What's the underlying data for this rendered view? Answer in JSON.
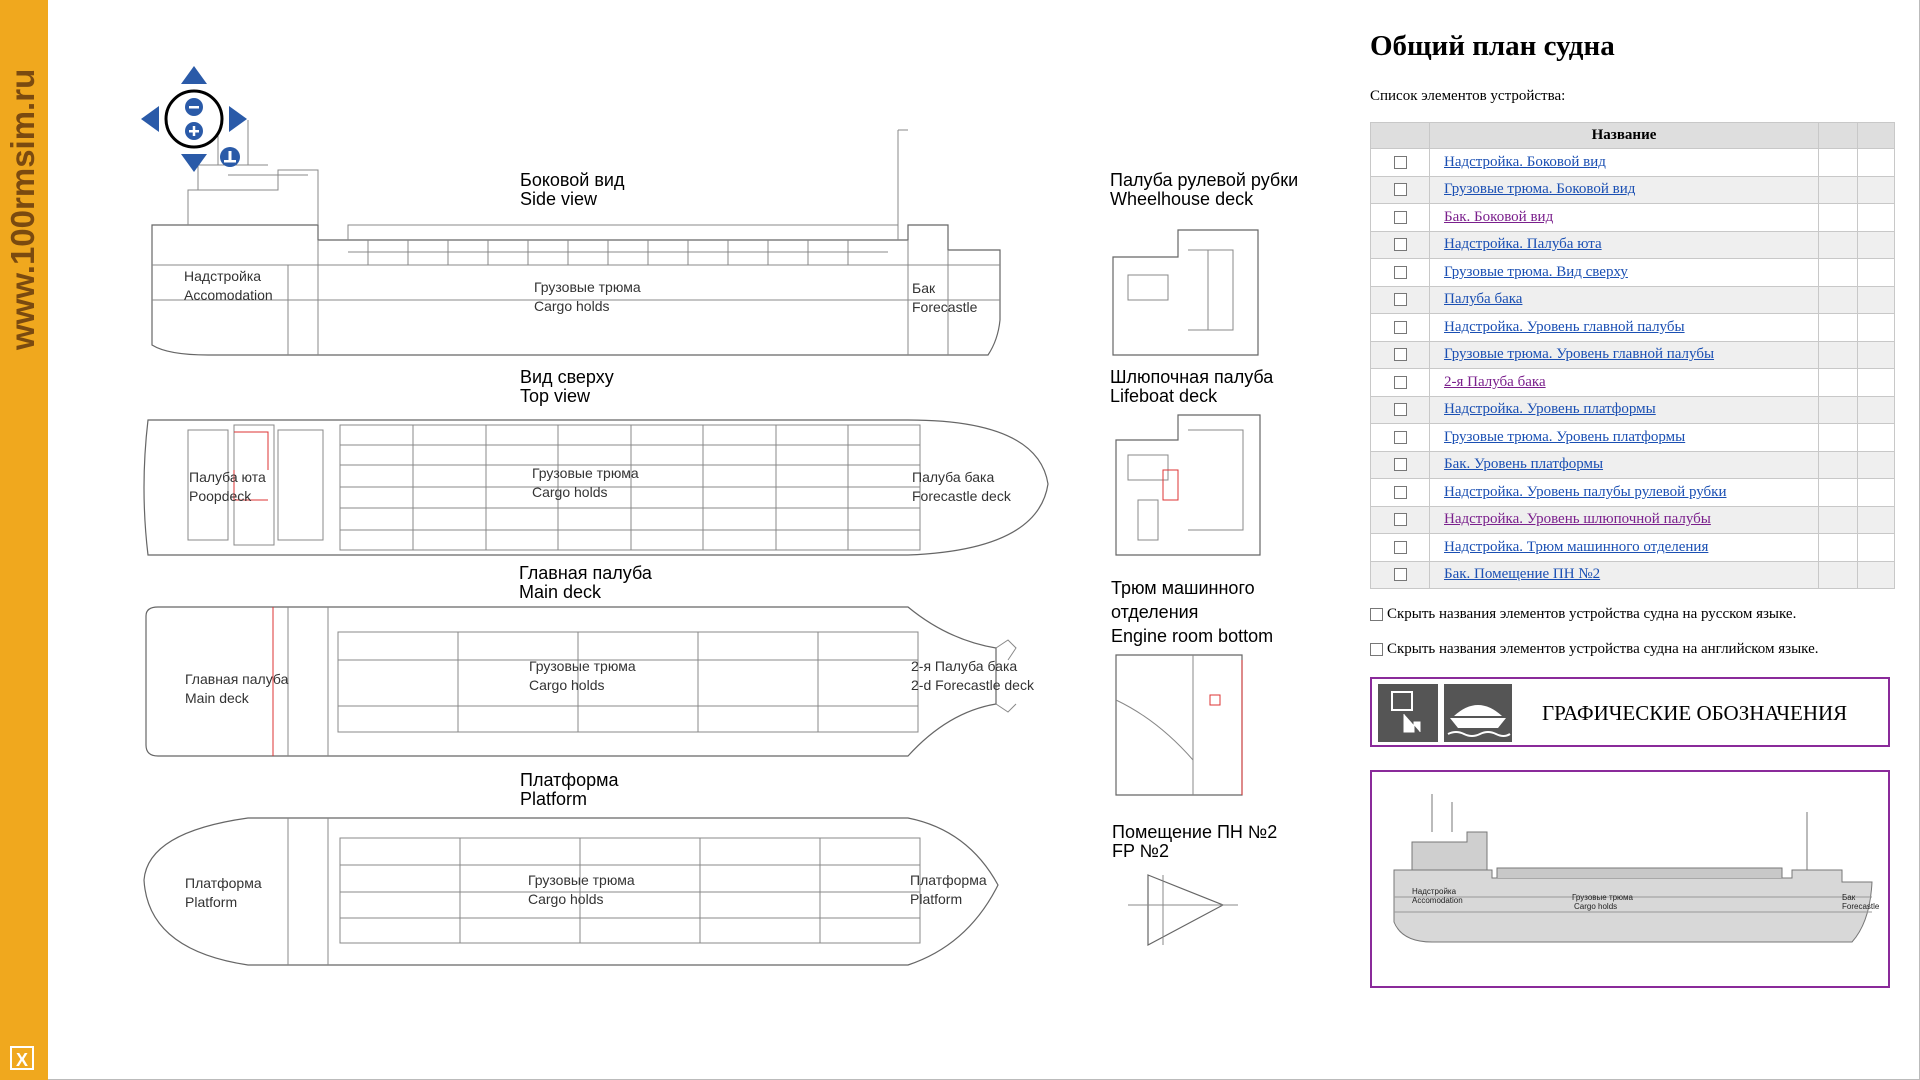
{
  "sidebar": {
    "site": "www.100rmsim.ru",
    "close_label": "X"
  },
  "nav": {
    "zoom_out": "zoom-out",
    "zoom_in": "zoom-in",
    "reset": "reset"
  },
  "views": {
    "side": {
      "title_ru": "Боковой вид",
      "title_en": "Side view",
      "accom_ru": "Надстройка",
      "accom_en": "Accomodation",
      "cargo_ru": "Грузовые трюма",
      "cargo_en": "Cargo holds",
      "fore_ru": "Бак",
      "fore_en": "Forecastle"
    },
    "top": {
      "title_ru": "Вид сверху",
      "title_en": "Top view",
      "poop_ru": "Палуба юта",
      "poop_en": "Poopdeck",
      "cargo_ru": "Грузовые трюма",
      "cargo_en": "Cargo holds",
      "fore_ru": "Палуба бака",
      "fore_en": "Forecastle deck"
    },
    "main": {
      "title_ru": "Главная палуба",
      "title_en": "Main deck",
      "deck_ru": "Главная палуба",
      "deck_en": "Main deck",
      "cargo_ru": "Грузовые трюма",
      "cargo_en": "Cargo holds",
      "fore_ru": "2-я Палуба бака",
      "fore_en": "2-d Forecastle deck"
    },
    "platform": {
      "title_ru": "Платформа",
      "title_en": "Platform",
      "left_ru": "Платформа",
      "left_en": "Platform",
      "cargo_ru": "Грузовые трюма",
      "cargo_en": "Cargo holds",
      "right_ru": "Платформа",
      "right_en": "Platform"
    },
    "wheelhouse": {
      "title_ru": "Палуба рулевой рубки",
      "title_en": "Wheelhouse deck"
    },
    "lifeboat": {
      "title_ru": "Шлюпочная палуба",
      "title_en": "Lifeboat deck"
    },
    "engine": {
      "title_ru1": "Трюм машинного",
      "title_ru2": "отделения",
      "title_en": "Engine room bottom"
    },
    "fp": {
      "title_ru": "Помещение ПН №2",
      "title_en": "FP №2"
    }
  },
  "panel": {
    "title": "Общий план судна",
    "subtitle": "Список элементов устройства:",
    "column_header": "Название",
    "items": [
      {
        "label": "Надстройка. Боковой вид",
        "visited": false
      },
      {
        "label": "Грузовые трюма. Боковой вид",
        "visited": false
      },
      {
        "label": "Бак. Боковой вид",
        "visited": true
      },
      {
        "label": "Надстройка. Палуба юта",
        "visited": false
      },
      {
        "label": "Грузовые трюма. Вид сверху",
        "visited": false
      },
      {
        "label": "Палуба бака",
        "visited": false
      },
      {
        "label": "Надстройка. Уровень главной палубы",
        "visited": false
      },
      {
        "label": "Грузовые трюма. Уровень главной палубы",
        "visited": false
      },
      {
        "label": "2-я Палуба бака",
        "visited": true
      },
      {
        "label": "Надстройка. Уровень платформы",
        "visited": false
      },
      {
        "label": "Грузовые трюма. Уровень платформы",
        "visited": false
      },
      {
        "label": "Бак. Уровень платформы",
        "visited": false
      },
      {
        "label": "Надстройка. Уровень палубы рулевой рубки",
        "visited": false
      },
      {
        "label": "Надстройка. Уровень шлюпочной палубы",
        "visited": true
      },
      {
        "label": "Надстройка. Трюм машинного отделения",
        "visited": false
      },
      {
        "label": "Бак. Помещение ПН №2",
        "visited": false
      }
    ],
    "hide_ru": "Скрыть названия элементов устройства судна на русском языке.",
    "hide_en": "Скрыть названия элементов устройства судна на английском языке.",
    "legend_label": "ГРАФИЧЕСКИЕ ОБОЗНАЧЕНИЯ",
    "thumb": {
      "accom_ru": "Надстройка",
      "accom_en": "Accomodation",
      "cargo_ru": "Грузовые трюма",
      "cargo_en": "Cargo holds",
      "fore_ru": "Бак",
      "fore_en": "Forecastle"
    }
  },
  "colors": {
    "sidebar": "#f0a81e",
    "link": "#1a4fb3",
    "visited": "#7a1f8c",
    "frame": "#8a2a9a",
    "nav": "#2a5aa8"
  }
}
